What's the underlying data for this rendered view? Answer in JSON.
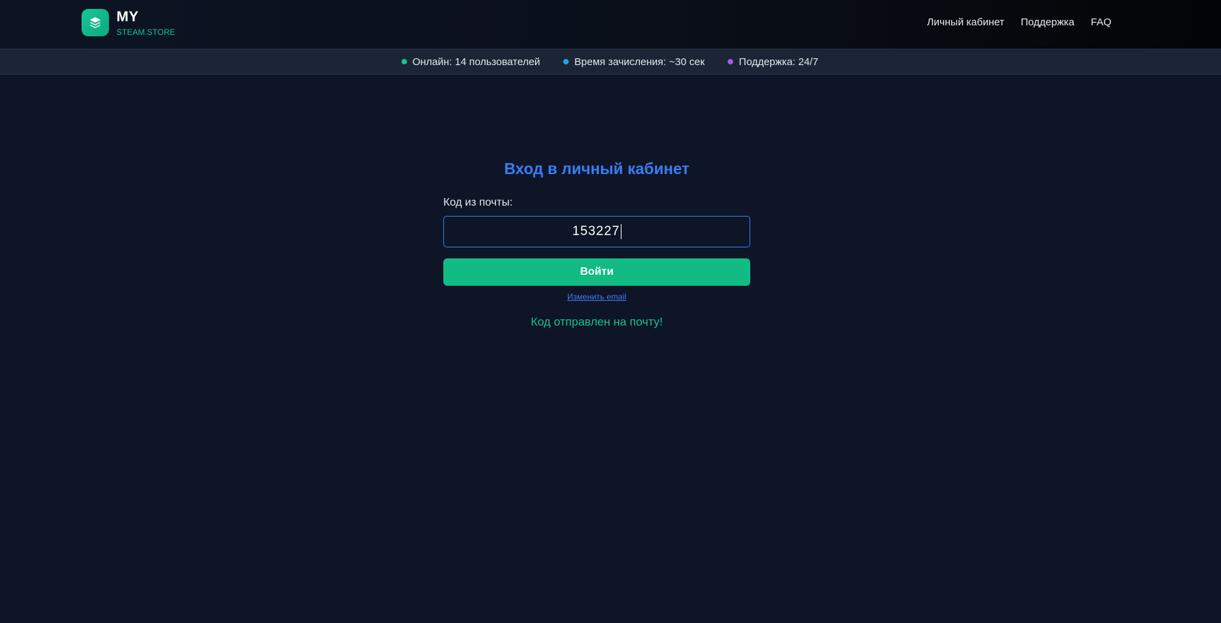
{
  "header": {
    "logo_title": "MY",
    "logo_subtitle": "STEAM.STORE",
    "logo_icon": "layers-icon",
    "nav": [
      {
        "label": "Личный кабинет"
      },
      {
        "label": "Поддержка"
      },
      {
        "label": "FAQ"
      }
    ]
  },
  "info_bar": [
    {
      "text": "Онлайн: 14 пользователей",
      "color": "#16c190"
    },
    {
      "text": "Время зачисления: ~30 сек",
      "color": "#1fa6d8"
    },
    {
      "text": "Поддержка: 24/7",
      "color": "#a25af0"
    }
  ],
  "login": {
    "title": "Вход в личный кабинет",
    "code_label": "Код из почты:",
    "code_value": "153227",
    "submit_label": "Войти",
    "change_email_label": "Изменить email",
    "status_message": "Код отправлен на почту!"
  },
  "colors": {
    "accent_green": "#12bb84",
    "accent_blue": "#3b7cf3",
    "background": "#0e1526"
  }
}
